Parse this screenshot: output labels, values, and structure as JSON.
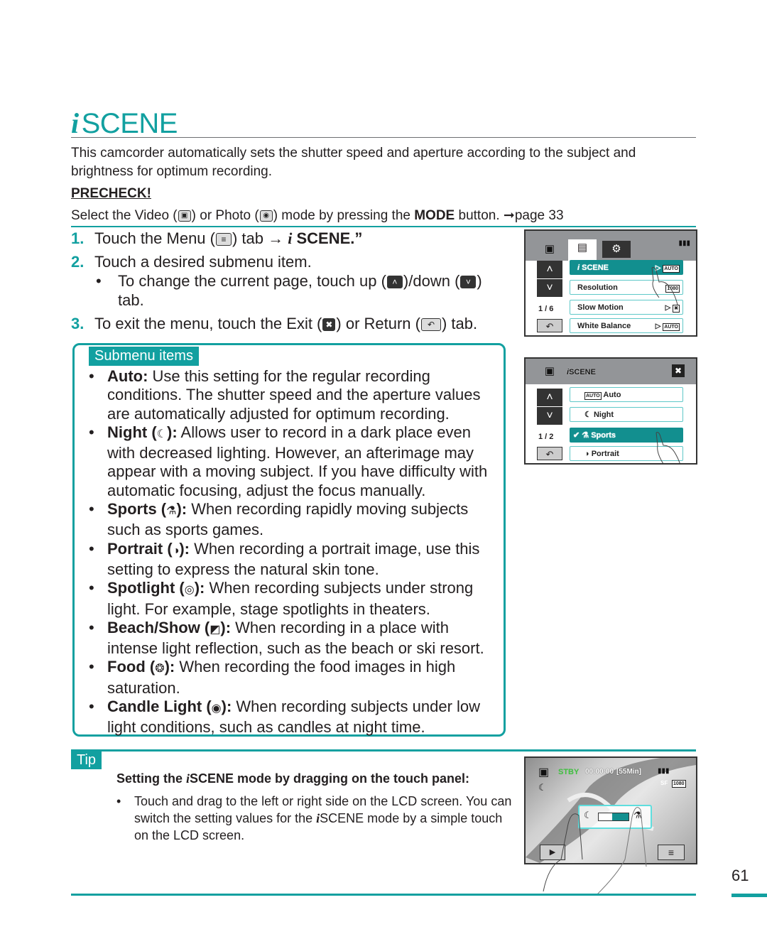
{
  "title": {
    "i": "i",
    "text": "SCENE"
  },
  "intro": "This camcorder automatically sets the shutter speed and aperture according to the subject and brightness for optimum recording.",
  "precheck": {
    "heading": "PRECHECK!",
    "t1": "Select the Video (",
    "t2": ") or Photo (",
    "t3": ") mode by pressing the ",
    "mode": "MODE",
    "t4": " button. ",
    "ref": "➞page 33"
  },
  "steps": [
    {
      "num": "1.",
      "a": "Touch the Menu (",
      "b": ") tab → ",
      "i": "i",
      "c": "SCENE.”"
    },
    {
      "num": "2.",
      "a": "Touch a desired submenu item.",
      "sub": {
        "a": "To change the current page, touch up (",
        "b": ")/down (",
        "c": ") tab."
      }
    },
    {
      "num": "3.",
      "a": "To exit the menu, touch the Exit (",
      "b": ") or Return (",
      "c": ") tab."
    }
  ],
  "icons": {
    "menu": "≡",
    "up": "˄",
    "down": "˅",
    "exit": "✖",
    "return": "↶"
  },
  "submenu": {
    "label": "Submenu items",
    "items": [
      {
        "name": "Auto:",
        "icon": "",
        "desc": " Use this setting for the regular recording conditions. The shutter speed and the aperture values are automatically adjusted for optimum recording."
      },
      {
        "name": "Night (",
        "icon": "☾",
        "tail": "):",
        "desc": " Allows user to record in a dark place even with decreased lighting. However, an afterimage may appear with a moving subject. If you have difficulty with automatic focusing, adjust the focus manually."
      },
      {
        "name": "Sports (",
        "icon": "⚗",
        "tail": "):",
        "desc": " When recording rapidly moving subjects such as sports games."
      },
      {
        "name": "Portrait (",
        "icon": "◑",
        "tail": "):",
        "desc": " When recording a portrait image, use this setting to express the natural skin tone."
      },
      {
        "name": "Spotlight (",
        "icon": "◎",
        "tail": "):",
        "desc": " When recording subjects under strong light. For example, stage spotlights in theaters."
      },
      {
        "name": "Beach/Show (",
        "icon": "◩",
        "tail": "):",
        "desc": " When recording in a place with intense light reflection, such as the beach or ski resort."
      },
      {
        "name": "Food (",
        "icon": "❂",
        "tail": "):",
        "desc": " When recording the food images in high saturation."
      },
      {
        "name": "Candle Light (",
        "icon": "◉",
        "tail": "):",
        "desc": " When recording subjects under low light conditions, such as candles at night time."
      }
    ]
  },
  "tip": {
    "label": "Tip",
    "title_a": "Setting the ",
    "title_i": "i",
    "title_b": "SCENE mode by dragging on the touch panel:",
    "bullet_a": "Touch and drag to the left or right side on the LCD screen. You can switch the setting values for the ",
    "bullet_i": "i",
    "bullet_b": "SCENE mode by a simple touch on the LCD screen."
  },
  "lcd1": {
    "page": "1 / 6",
    "battery": "▮▮▮",
    "rows": [
      {
        "label": "SCENE",
        "prefix": "i ",
        "value": "AUTO",
        "arrow": "▷",
        "selected": true
      },
      {
        "label": "Resolution",
        "value": "1080",
        "arrow": "",
        "selected": false
      },
      {
        "label": "Slow Motion",
        "value": "✖",
        "arrow": "▷",
        "selected": false
      },
      {
        "label": "White Balance",
        "value": "AUTO",
        "arrow": "▷",
        "selected": false
      }
    ]
  },
  "lcd2": {
    "title": "SCENE",
    "title_i": "i",
    "page": "1 / 2",
    "rows": [
      {
        "label": "Auto",
        "icon": "AUTO",
        "selected": false
      },
      {
        "label": "Night",
        "icon": "☾",
        "selected": false
      },
      {
        "label": "Sports",
        "icon": "✔ ⚗",
        "selected": true
      },
      {
        "label": "Portrait",
        "icon": "◑",
        "selected": false
      }
    ]
  },
  "lcd3": {
    "status": "STBY",
    "timecode": "00:00:00",
    "remaining": "[55Min]",
    "quality": "SF",
    "resolution": "1080",
    "status_color": "#3fbf3f"
  },
  "page_number": "61"
}
